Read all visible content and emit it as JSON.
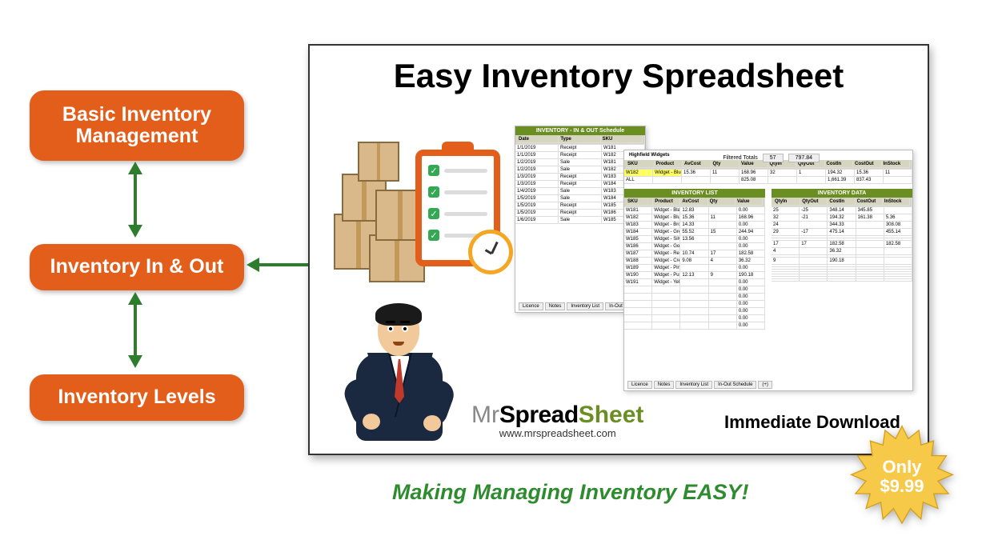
{
  "pills": {
    "p1": "Basic Inventory Management",
    "p2": "Inventory In & Out",
    "p3": "Inventory Levels"
  },
  "panel": {
    "title": "Easy Inventory Spreadsheet",
    "brand_mr": "Mr",
    "brand_spread": "Spread",
    "brand_sheet": "Sheet",
    "brand_url": "www.mrspreadsheet.com",
    "download": "Immediate Download"
  },
  "tagline": "Making Managing Inventory EASY!",
  "burst": {
    "line1": "Only",
    "line2": "$9.99"
  },
  "t1": {
    "title": "INVENTORY - IN & OUT Schedule",
    "headers": [
      "Date",
      "Type",
      "SKU"
    ],
    "rows": [
      [
        "1/1/2019",
        "Receipt",
        "W181"
      ],
      [
        "1/1/2019",
        "Receipt",
        "W182"
      ],
      [
        "1/2/2019",
        "Sale",
        "W181"
      ],
      [
        "1/2/2019",
        "Sale",
        "W182"
      ],
      [
        "1/3/2019",
        "Receipt",
        "W183"
      ],
      [
        "1/3/2019",
        "Receipt",
        "W184"
      ],
      [
        "1/4/2019",
        "Sale",
        "W183"
      ],
      [
        "1/5/2019",
        "Sale",
        "W184"
      ],
      [
        "1/5/2019",
        "Receipt",
        "W185"
      ],
      [
        "1/5/2019",
        "Receipt",
        "W186"
      ],
      [
        "1/6/2019",
        "Sale",
        "W185"
      ]
    ],
    "tabs": [
      "Licence",
      "Notes",
      "Inventory List",
      "In-Out"
    ]
  },
  "t2": {
    "top_label": "Highfield Widgets",
    "filtered_label": "Filtered Totals",
    "filtered_vals": [
      "57",
      "797.84"
    ],
    "top_headers": [
      "SKU",
      "Product",
      "AvCost",
      "Qty",
      "Value",
      "QtyIn",
      "QtyOut",
      "CostIn",
      "CostOut",
      "InStock"
    ],
    "top_rows": [
      [
        "W182",
        "Widget - Blue",
        "15.36",
        "11",
        "168.96",
        "32",
        "1",
        "194.32",
        "15.36",
        "11"
      ],
      [
        "ALL",
        "",
        "",
        "",
        "825.08",
        "",
        "",
        "1,661.39",
        "837.43",
        ""
      ]
    ],
    "list_title": "INVENTORY LIST",
    "data_title": "INVENTORY DATA",
    "list_headers": [
      "SKU",
      "Product",
      "AvCost",
      "Qty",
      "Value"
    ],
    "data_headers": [
      "QtyIn",
      "QtyOut",
      "CostIn",
      "CostOut",
      "InStock"
    ],
    "list_rows": [
      [
        "W181",
        "Widget - Black",
        "12.83",
        "",
        "0.00"
      ],
      [
        "W182",
        "Widget - Blue",
        "15.36",
        "11",
        "168.96"
      ],
      [
        "W183",
        "Widget - Brown",
        "14.33",
        "",
        "0.00"
      ],
      [
        "W184",
        "Widget - Green",
        "55.52",
        "15",
        "244.94"
      ],
      [
        "W185",
        "Widget - Silver",
        "13.56",
        "",
        "0.00"
      ],
      [
        "W186",
        "Widget - Gold",
        "",
        "",
        "0.00"
      ],
      [
        "W187",
        "Widget - Red",
        "10.74",
        "17",
        "182.58"
      ],
      [
        "W188",
        "Widget - Cream",
        "9.08",
        "4",
        "36.32"
      ],
      [
        "W189",
        "Widget - Pink",
        "",
        "",
        "0.00"
      ],
      [
        "W190",
        "Widget - Purple",
        "12.13",
        "9",
        "190.18"
      ],
      [
        "W191",
        "Widget - Yellow",
        "",
        "",
        "0.00"
      ],
      [
        "",
        "",
        "",
        "",
        "0.00"
      ],
      [
        "",
        "",
        "",
        "",
        "0.00"
      ],
      [
        "",
        "",
        "",
        "",
        "0.00"
      ],
      [
        "",
        "",
        "",
        "",
        "0.00"
      ],
      [
        "",
        "",
        "",
        "",
        "0.00"
      ],
      [
        "",
        "",
        "",
        "",
        "0.00"
      ]
    ],
    "data_rows": [
      [
        "25",
        "-25",
        "348.14",
        "345.85",
        ""
      ],
      [
        "32",
        "-21",
        "194.32",
        "161.38",
        "5.36"
      ],
      [
        "24",
        "",
        "344.33",
        "",
        "308.08"
      ],
      [
        "29",
        "-17",
        "475.14",
        "",
        "455.14"
      ],
      [
        "",
        "",
        "",
        "",
        ""
      ],
      [
        "",
        "",
        "",
        "",
        ""
      ],
      [
        "17",
        "17",
        "182.58",
        "",
        "182.58"
      ],
      [
        "4",
        "",
        "36.32",
        "",
        ""
      ],
      [
        "",
        "",
        "",
        "",
        ""
      ],
      [
        "9",
        "",
        "190.18",
        "",
        ""
      ],
      [
        "",
        "",
        "",
        "",
        ""
      ],
      [
        "",
        "",
        "",
        "",
        ""
      ],
      [
        "",
        "",
        "",
        "",
        ""
      ],
      [
        "",
        "",
        "",
        "",
        ""
      ],
      [
        "",
        "",
        "",
        "",
        ""
      ],
      [
        "",
        "",
        "",
        "",
        ""
      ],
      [
        "",
        "",
        "",
        "",
        ""
      ]
    ],
    "tabs": [
      "Licence",
      "Notes",
      "Inventory List",
      "In-Out Schedule",
      "(+)"
    ]
  }
}
